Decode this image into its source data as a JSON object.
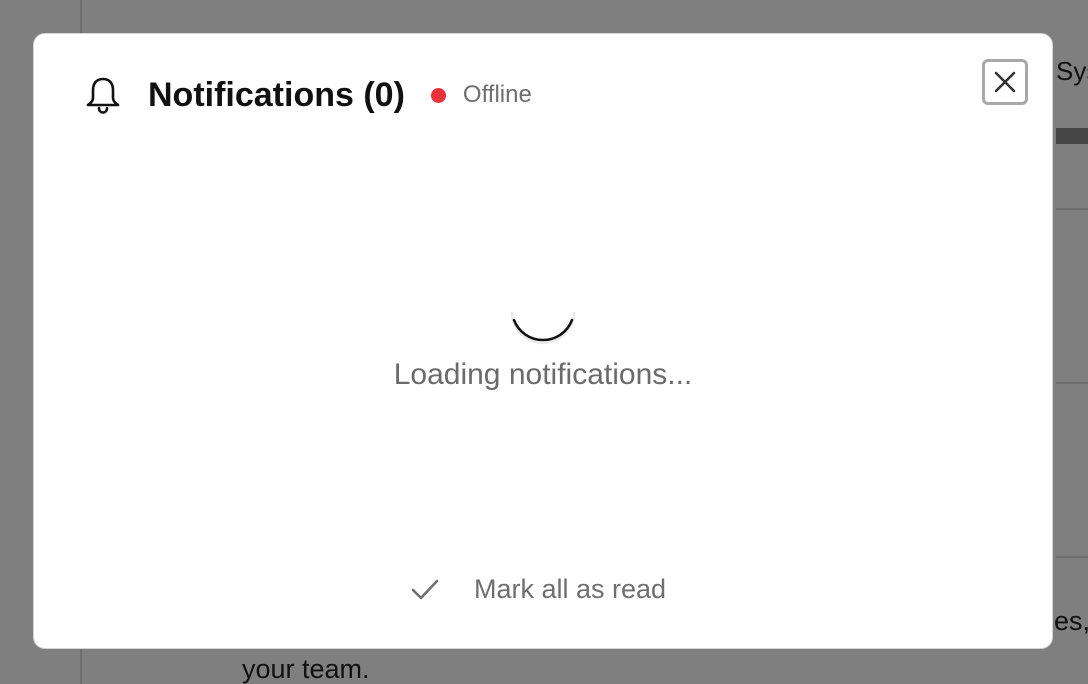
{
  "background": {
    "header_fragment": "Syste",
    "side_fragment": "es,",
    "footer_fragment": "your team."
  },
  "modal": {
    "title": "Notifications (0)",
    "status": {
      "label": "Offline",
      "color": "#e8333b"
    },
    "icons": {
      "bell": "bell-icon",
      "close": "close-icon",
      "check": "check-icon",
      "spinner": "spinner-icon"
    },
    "loading_text": "Loading notifications...",
    "mark_all_read_label": "Mark all as read"
  }
}
